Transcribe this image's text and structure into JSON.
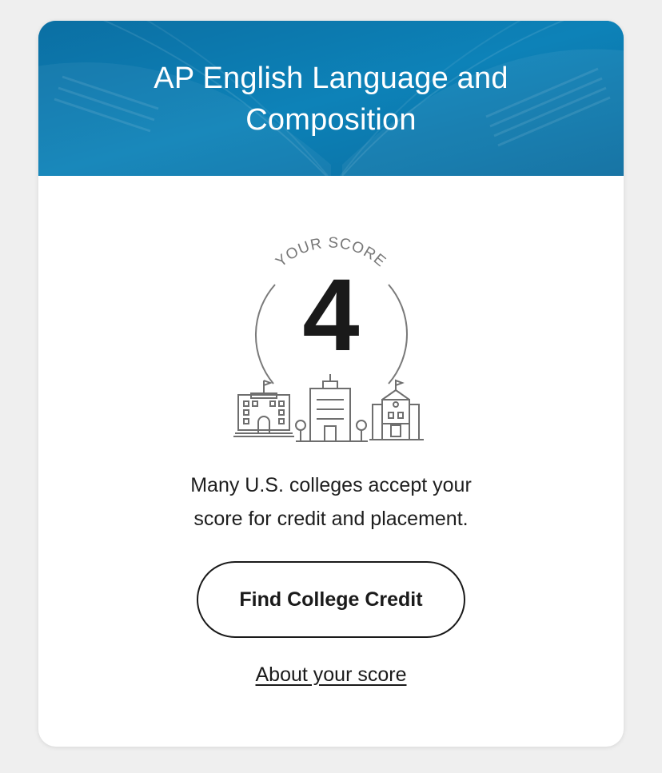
{
  "card": {
    "title_line1": "AP English Language and",
    "title_line2": "Composition",
    "score_label": "YOUR SCORE",
    "score_value": "4",
    "message_line1": "Many U.S. colleges accept your",
    "message_line2": "score for credit and placement.",
    "primary_button_label": "Find College Credit",
    "secondary_link_label": "About your score"
  },
  "icons": {
    "banner_background": "open-book-image",
    "score_illustration": "college-buildings-icon"
  },
  "colors": {
    "banner": "#0a78ad",
    "text": "#1a1a1a",
    "card_background": "#ffffff",
    "page_background": "#efefef"
  }
}
